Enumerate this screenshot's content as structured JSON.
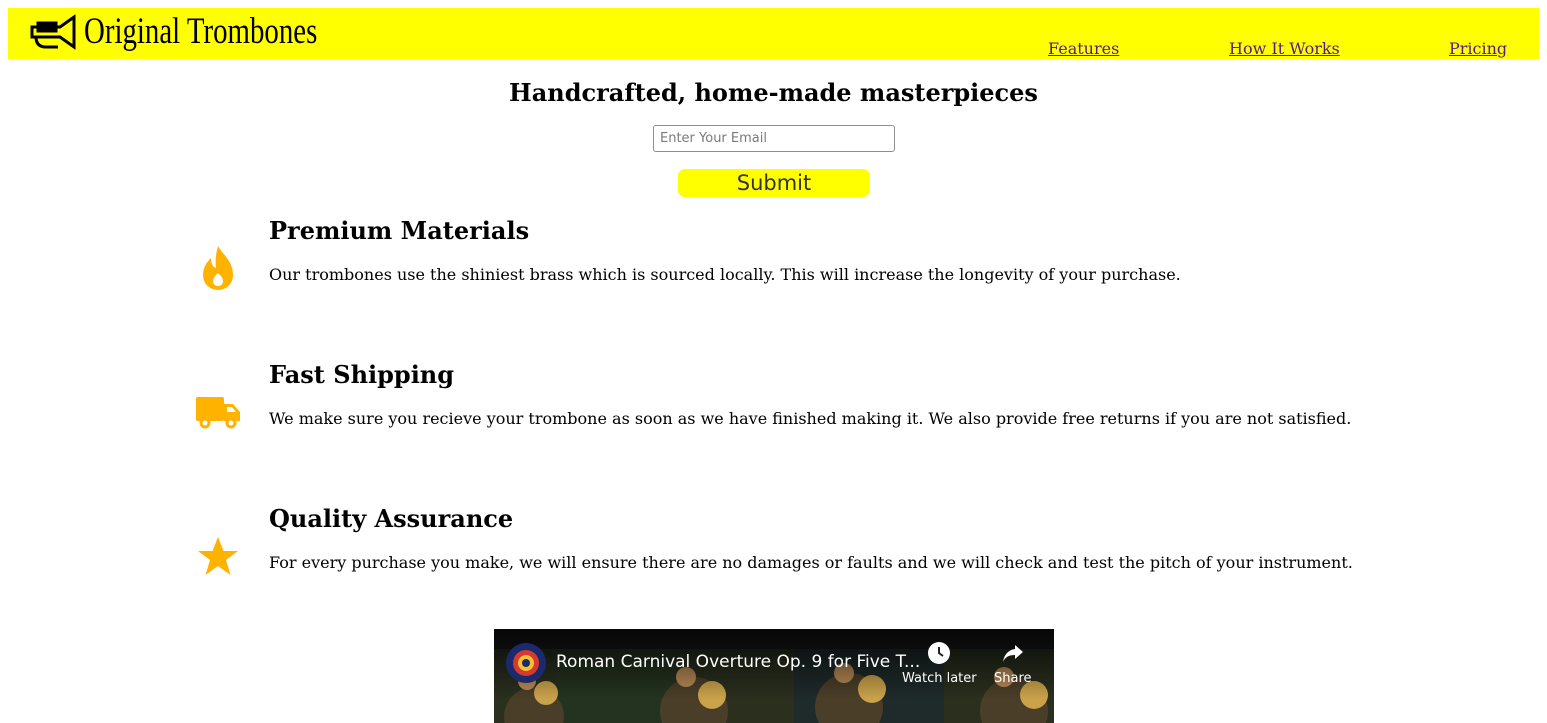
{
  "header": {
    "brand": "Original Trombones",
    "logo_icon": "trumpet-icon",
    "background": "#ffff00",
    "nav": [
      {
        "label": "Features"
      },
      {
        "label": "How It Works"
      },
      {
        "label": "Pricing"
      }
    ]
  },
  "hero": {
    "title": "Handcrafted, home-made masterpieces",
    "email_placeholder": "Enter Your Email",
    "email_value": "",
    "submit_label": "Submit"
  },
  "features": [
    {
      "icon": "fire-icon",
      "title": "Premium Materials",
      "description": "Our trombones use the shiniest brass which is sourced locally. This will increase the longevity of your purchase."
    },
    {
      "icon": "truck-icon",
      "title": "Fast Shipping",
      "description": "We make sure you recieve your trombone as soon as we have finished making it. We also provide free returns if you are not satisfied."
    },
    {
      "icon": "star-icon",
      "title": "Quality Assurance",
      "description": "For every purchase you make, we will ensure there are no damages or faults and we will check and test the pitch of your instrument."
    }
  ],
  "video": {
    "title": "Roman Carnival Overture Op. 9 for Five T...",
    "watch_later_label": "Watch later",
    "share_label": "Share"
  },
  "colors": {
    "accent_yellow": "#ffff00",
    "icon_orange": "#ffb300",
    "link": "#551a8b"
  }
}
